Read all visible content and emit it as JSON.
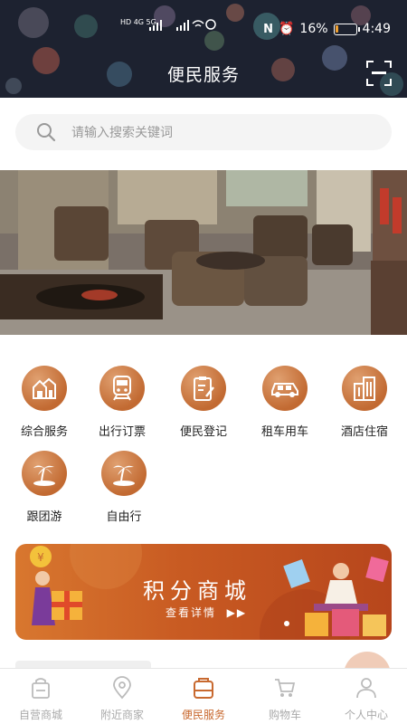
{
  "status_bar": {
    "network_left": "HD 4G 5G",
    "battery": "16%",
    "battery_level": 0.16,
    "time": "4:49"
  },
  "header": {
    "title": "便民服务",
    "scan_icon": "scan-icon"
  },
  "search": {
    "placeholder": "请输入搜索关键词",
    "icon": "search-icon"
  },
  "banner": {
    "icon": "hotel-lobby-photo"
  },
  "services": [
    {
      "label": "综合服务",
      "icon": "houses-icon"
    },
    {
      "label": "出行订票",
      "icon": "train-icon"
    },
    {
      "label": "便民登记",
      "icon": "clipboard-icon"
    },
    {
      "label": "租车用车",
      "icon": "car-icon"
    },
    {
      "label": "酒店住宿",
      "icon": "buildings-icon"
    },
    {
      "label": "跟团游",
      "icon": "palm-island-icon"
    },
    {
      "label": "自由行",
      "icon": "palm-island-icon"
    }
  ],
  "promo": {
    "title": "积分商城",
    "subtitle": "查看详情",
    "accent": "#c85a22"
  },
  "tabbar": [
    {
      "label": "自营商城",
      "icon": "shop-bag-icon",
      "active": false
    },
    {
      "label": "附近商家",
      "icon": "location-pin-icon",
      "active": false
    },
    {
      "label": "便民服务",
      "icon": "service-box-icon",
      "active": true
    },
    {
      "label": "购物车",
      "icon": "cart-icon",
      "active": false
    },
    {
      "label": "个人中心",
      "icon": "person-icon",
      "active": false
    }
  ],
  "colors": {
    "header_bg": "#1d2230",
    "accent": "#c8692f",
    "tab_inactive": "#aaaaaa"
  }
}
